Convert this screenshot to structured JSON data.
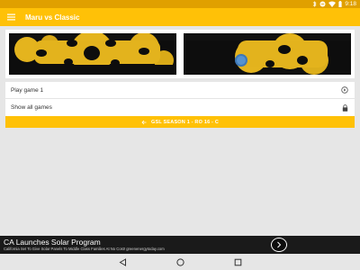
{
  "status_bar": {
    "time": "9:18"
  },
  "app_bar": {
    "title": "Maru vs Classic"
  },
  "list": {
    "play_game_label": "Play game 1",
    "show_all_label": "Show all games"
  },
  "season_bar": {
    "label": "GSL SEASON 1 - RO 16 - C"
  },
  "ad": {
    "headline": "CA Launches Solar Program",
    "subtext": "California Set To Give Solar Panels To Middle Class Families At No Cost! greenenergytoday.com"
  },
  "colors": {
    "status_bar": "#e0a000",
    "app_bar": "#ffc107",
    "map_dark": "#0d0d0d",
    "map_yellow": "#e4b41e",
    "background": "#e6e6e6"
  }
}
